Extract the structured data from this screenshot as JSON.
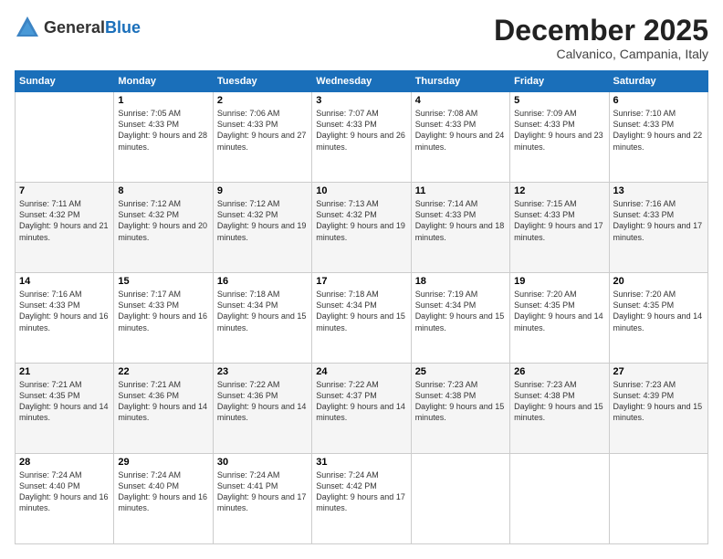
{
  "logo": {
    "general": "General",
    "blue": "Blue"
  },
  "header": {
    "month": "December 2025",
    "location": "Calvanico, Campania, Italy"
  },
  "weekdays": [
    "Sunday",
    "Monday",
    "Tuesday",
    "Wednesday",
    "Thursday",
    "Friday",
    "Saturday"
  ],
  "weeks": [
    [
      {
        "day": "",
        "sunrise": "",
        "sunset": "",
        "daylight": ""
      },
      {
        "day": "1",
        "sunrise": "Sunrise: 7:05 AM",
        "sunset": "Sunset: 4:33 PM",
        "daylight": "Daylight: 9 hours and 28 minutes."
      },
      {
        "day": "2",
        "sunrise": "Sunrise: 7:06 AM",
        "sunset": "Sunset: 4:33 PM",
        "daylight": "Daylight: 9 hours and 27 minutes."
      },
      {
        "day": "3",
        "sunrise": "Sunrise: 7:07 AM",
        "sunset": "Sunset: 4:33 PM",
        "daylight": "Daylight: 9 hours and 26 minutes."
      },
      {
        "day": "4",
        "sunrise": "Sunrise: 7:08 AM",
        "sunset": "Sunset: 4:33 PM",
        "daylight": "Daylight: 9 hours and 24 minutes."
      },
      {
        "day": "5",
        "sunrise": "Sunrise: 7:09 AM",
        "sunset": "Sunset: 4:33 PM",
        "daylight": "Daylight: 9 hours and 23 minutes."
      },
      {
        "day": "6",
        "sunrise": "Sunrise: 7:10 AM",
        "sunset": "Sunset: 4:33 PM",
        "daylight": "Daylight: 9 hours and 22 minutes."
      }
    ],
    [
      {
        "day": "7",
        "sunrise": "Sunrise: 7:11 AM",
        "sunset": "Sunset: 4:32 PM",
        "daylight": "Daylight: 9 hours and 21 minutes."
      },
      {
        "day": "8",
        "sunrise": "Sunrise: 7:12 AM",
        "sunset": "Sunset: 4:32 PM",
        "daylight": "Daylight: 9 hours and 20 minutes."
      },
      {
        "day": "9",
        "sunrise": "Sunrise: 7:12 AM",
        "sunset": "Sunset: 4:32 PM",
        "daylight": "Daylight: 9 hours and 19 minutes."
      },
      {
        "day": "10",
        "sunrise": "Sunrise: 7:13 AM",
        "sunset": "Sunset: 4:32 PM",
        "daylight": "Daylight: 9 hours and 19 minutes."
      },
      {
        "day": "11",
        "sunrise": "Sunrise: 7:14 AM",
        "sunset": "Sunset: 4:33 PM",
        "daylight": "Daylight: 9 hours and 18 minutes."
      },
      {
        "day": "12",
        "sunrise": "Sunrise: 7:15 AM",
        "sunset": "Sunset: 4:33 PM",
        "daylight": "Daylight: 9 hours and 17 minutes."
      },
      {
        "day": "13",
        "sunrise": "Sunrise: 7:16 AM",
        "sunset": "Sunset: 4:33 PM",
        "daylight": "Daylight: 9 hours and 17 minutes."
      }
    ],
    [
      {
        "day": "14",
        "sunrise": "Sunrise: 7:16 AM",
        "sunset": "Sunset: 4:33 PM",
        "daylight": "Daylight: 9 hours and 16 minutes."
      },
      {
        "day": "15",
        "sunrise": "Sunrise: 7:17 AM",
        "sunset": "Sunset: 4:33 PM",
        "daylight": "Daylight: 9 hours and 16 minutes."
      },
      {
        "day": "16",
        "sunrise": "Sunrise: 7:18 AM",
        "sunset": "Sunset: 4:34 PM",
        "daylight": "Daylight: 9 hours and 15 minutes."
      },
      {
        "day": "17",
        "sunrise": "Sunrise: 7:18 AM",
        "sunset": "Sunset: 4:34 PM",
        "daylight": "Daylight: 9 hours and 15 minutes."
      },
      {
        "day": "18",
        "sunrise": "Sunrise: 7:19 AM",
        "sunset": "Sunset: 4:34 PM",
        "daylight": "Daylight: 9 hours and 15 minutes."
      },
      {
        "day": "19",
        "sunrise": "Sunrise: 7:20 AM",
        "sunset": "Sunset: 4:35 PM",
        "daylight": "Daylight: 9 hours and 14 minutes."
      },
      {
        "day": "20",
        "sunrise": "Sunrise: 7:20 AM",
        "sunset": "Sunset: 4:35 PM",
        "daylight": "Daylight: 9 hours and 14 minutes."
      }
    ],
    [
      {
        "day": "21",
        "sunrise": "Sunrise: 7:21 AM",
        "sunset": "Sunset: 4:35 PM",
        "daylight": "Daylight: 9 hours and 14 minutes."
      },
      {
        "day": "22",
        "sunrise": "Sunrise: 7:21 AM",
        "sunset": "Sunset: 4:36 PM",
        "daylight": "Daylight: 9 hours and 14 minutes."
      },
      {
        "day": "23",
        "sunrise": "Sunrise: 7:22 AM",
        "sunset": "Sunset: 4:36 PM",
        "daylight": "Daylight: 9 hours and 14 minutes."
      },
      {
        "day": "24",
        "sunrise": "Sunrise: 7:22 AM",
        "sunset": "Sunset: 4:37 PM",
        "daylight": "Daylight: 9 hours and 14 minutes."
      },
      {
        "day": "25",
        "sunrise": "Sunrise: 7:23 AM",
        "sunset": "Sunset: 4:38 PM",
        "daylight": "Daylight: 9 hours and 15 minutes."
      },
      {
        "day": "26",
        "sunrise": "Sunrise: 7:23 AM",
        "sunset": "Sunset: 4:38 PM",
        "daylight": "Daylight: 9 hours and 15 minutes."
      },
      {
        "day": "27",
        "sunrise": "Sunrise: 7:23 AM",
        "sunset": "Sunset: 4:39 PM",
        "daylight": "Daylight: 9 hours and 15 minutes."
      }
    ],
    [
      {
        "day": "28",
        "sunrise": "Sunrise: 7:24 AM",
        "sunset": "Sunset: 4:40 PM",
        "daylight": "Daylight: 9 hours and 16 minutes."
      },
      {
        "day": "29",
        "sunrise": "Sunrise: 7:24 AM",
        "sunset": "Sunset: 4:40 PM",
        "daylight": "Daylight: 9 hours and 16 minutes."
      },
      {
        "day": "30",
        "sunrise": "Sunrise: 7:24 AM",
        "sunset": "Sunset: 4:41 PM",
        "daylight": "Daylight: 9 hours and 17 minutes."
      },
      {
        "day": "31",
        "sunrise": "Sunrise: 7:24 AM",
        "sunset": "Sunset: 4:42 PM",
        "daylight": "Daylight: 9 hours and 17 minutes."
      },
      {
        "day": "",
        "sunrise": "",
        "sunset": "",
        "daylight": ""
      },
      {
        "day": "",
        "sunrise": "",
        "sunset": "",
        "daylight": ""
      },
      {
        "day": "",
        "sunrise": "",
        "sunset": "",
        "daylight": ""
      }
    ]
  ]
}
